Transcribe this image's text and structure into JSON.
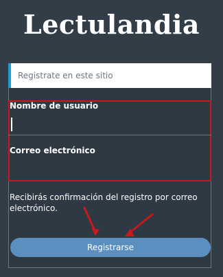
{
  "header": {
    "logo_text": "Lectulandia",
    "register_prompt": "Registrate en este sitio"
  },
  "form": {
    "username_label": "Nombre de usuario",
    "email_label": "Correo electrónico",
    "notice": "Recibirás confirmación del registro por correo electrónico.",
    "submit_label": "Registrarse"
  },
  "colors": {
    "background": "#333d47",
    "accent_blue": "#1f9bd7",
    "button_blue": "#5b8fc0",
    "annotation_red": "#c51b1b"
  }
}
